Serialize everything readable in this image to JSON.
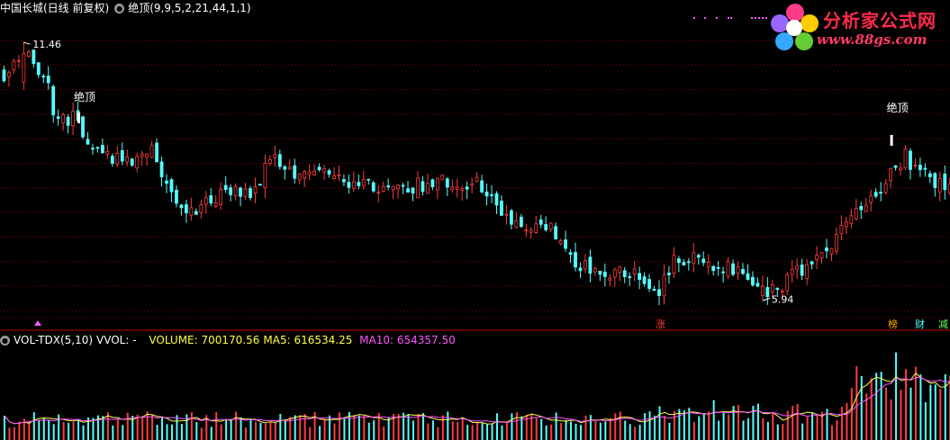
{
  "header": {
    "stock_title": "中国长城(日线 前复权)",
    "indicator_label": "绝顶(9,9,5,2,21,44,1,1)"
  },
  "volume_panel": {
    "indicator_name": "VOL-TDX(5,10)",
    "vvol_label": "VVOL: -",
    "volume_label": "VOLUME: 700170.56",
    "ma5_label": "MA5: 616534.25",
    "ma10_label": "MA10: 654357.50"
  },
  "watermark": {
    "brand": "分析家公式网",
    "url": "www.88gs.com"
  },
  "colors": {
    "up": "#ff3c3c",
    "down": "#54ffff",
    "grid": "#8b0000",
    "ma5": "#ffff55",
    "ma10": "#ff55ff",
    "header_yellow": "#ffff40",
    "header_magenta": "#ff55ff"
  },
  "markers": {
    "high_label": "11.46",
    "low_label": "5.94",
    "signal_label": "绝顶",
    "bottom_tags": [
      "涨",
      "榜",
      "财",
      "减"
    ]
  },
  "chart_data": {
    "type": "candlestick",
    "price_range": [
      5.6,
      12.0
    ],
    "highest": 11.46,
    "lowest": 5.94,
    "signals": [
      {
        "candle_index": 15,
        "label": "绝顶"
      },
      {
        "candle_index": 180,
        "label": "绝顶"
      }
    ],
    "close_path": [
      [
        0,
        10.8
      ],
      [
        5,
        11.1
      ],
      [
        9,
        10.5
      ],
      [
        10,
        9.9
      ],
      [
        15,
        9.8
      ],
      [
        18,
        9.2
      ],
      [
        22,
        8.9
      ],
      [
        28,
        9.0
      ],
      [
        30,
        9.1
      ],
      [
        32,
        8.6
      ],
      [
        35,
        7.9
      ],
      [
        37,
        7.8
      ],
      [
        41,
        8.1
      ],
      [
        50,
        8.3
      ],
      [
        53,
        8.7
      ],
      [
        55,
        8.9
      ],
      [
        60,
        8.6
      ],
      [
        63,
        8.8
      ],
      [
        70,
        8.4
      ],
      [
        80,
        8.3
      ],
      [
        88,
        8.5
      ],
      [
        97,
        8.4
      ],
      [
        100,
        7.9
      ],
      [
        106,
        7.5
      ],
      [
        109,
        7.7
      ],
      [
        112,
        7.3
      ],
      [
        117,
        6.7
      ],
      [
        120,
        6.5
      ],
      [
        125,
        6.6
      ],
      [
        130,
        6.4
      ],
      [
        133,
        6.2
      ],
      [
        136,
        6.9
      ],
      [
        140,
        6.8
      ],
      [
        145,
        6.7
      ],
      [
        148,
        6.6
      ],
      [
        150,
        6.4
      ],
      [
        153,
        6.1
      ],
      [
        157,
        6.2
      ],
      [
        162,
        6.6
      ],
      [
        165,
        6.9
      ],
      [
        169,
        7.3
      ],
      [
        172,
        7.6
      ],
      [
        176,
        8.2
      ],
      [
        180,
        8.6
      ],
      [
        183,
        9.0
      ],
      [
        187,
        8.6
      ],
      [
        191,
        8.3
      ]
    ],
    "volume_range": [
      0,
      2000000
    ],
    "last_volume": 700170.56,
    "ma5": 616534.25,
    "ma10": 654357.5
  }
}
